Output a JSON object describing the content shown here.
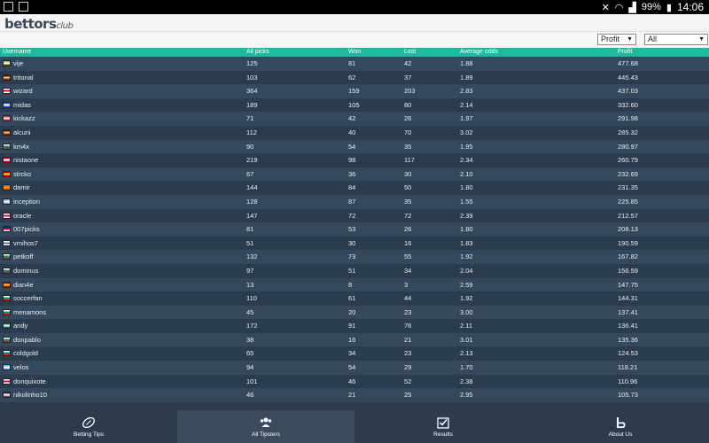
{
  "status": {
    "battery": "99%",
    "time": "14:06"
  },
  "app": {
    "logo_main": "bettors",
    "logo_sub": "club"
  },
  "filters": {
    "sort_value": "Profit",
    "range_value": "All"
  },
  "table": {
    "headers": {
      "username": "Username",
      "all_picks": "All picks",
      "won": "Won",
      "lost": "Lost",
      "average_odds": "Average odds",
      "profit": "Profit"
    },
    "rows": [
      {
        "username": "vije",
        "all": "125",
        "won": "81",
        "lost": "42",
        "odds": "1.88",
        "profit": "477.68",
        "flag": [
          "#ff9933",
          "#ffffff",
          "#138808"
        ]
      },
      {
        "username": "tritonal",
        "all": "103",
        "won": "62",
        "lost": "37",
        "odds": "1.89",
        "profit": "445.43",
        "flag": [
          "#002b7f",
          "#fcd116",
          "#ce1126"
        ]
      },
      {
        "username": "wizard",
        "all": "364",
        "won": "159",
        "lost": "203",
        "odds": "2.83",
        "profit": "437.03",
        "flag": [
          "#ffffff",
          "#d7141a",
          "#ffffff"
        ]
      },
      {
        "username": "midas",
        "all": "189",
        "won": "105",
        "lost": "80",
        "odds": "2.14",
        "profit": "332.60",
        "flag": [
          "#3a5fcd",
          "#ffffff",
          "#3a5fcd"
        ]
      },
      {
        "username": "kickazz",
        "all": "71",
        "won": "42",
        "lost": "26",
        "odds": "1.97",
        "profit": "291.98",
        "flag": [
          "#ed2939",
          "#ffffff",
          "#ed2939"
        ]
      },
      {
        "username": "alcuni",
        "all": "112",
        "won": "40",
        "lost": "70",
        "odds": "3.02",
        "profit": "285.32",
        "flag": [
          "#002b7f",
          "#fcd116",
          "#ce1126"
        ]
      },
      {
        "username": "km4x",
        "all": "90",
        "won": "54",
        "lost": "35",
        "odds": "1.95",
        "profit": "280.97",
        "flag": [
          "#ffffff",
          "#00966e",
          "#d62612"
        ]
      },
      {
        "username": "nistaone",
        "all": "219",
        "won": "98",
        "lost": "117",
        "odds": "2.34",
        "profit": "260.79",
        "flag": [
          "#c8102e",
          "#ffffff",
          "#c8102e"
        ]
      },
      {
        "username": "strcko",
        "all": "67",
        "won": "36",
        "lost": "30",
        "odds": "2.10",
        "profit": "232.69",
        "flag": [
          "#d20000",
          "#ffe600",
          "#d20000"
        ]
      },
      {
        "username": "damir",
        "all": "144",
        "won": "84",
        "lost": "50",
        "odds": "1.80",
        "profit": "231.35",
        "flag": [
          "#e35d1e",
          "#ff9f1c",
          "#e35d1e"
        ]
      },
      {
        "username": "inception",
        "all": "128",
        "won": "87",
        "lost": "35",
        "odds": "1.55",
        "profit": "225.85",
        "flag": [
          "#74acdf",
          "#ffffff",
          "#74acdf"
        ]
      },
      {
        "username": "oracle",
        "all": "147",
        "won": "72",
        "lost": "72",
        "odds": "2.39",
        "profit": "212.57",
        "flag": [
          "#ffffff",
          "#dc143c",
          "#ffffff"
        ]
      },
      {
        "username": "007picks",
        "all": "81",
        "won": "53",
        "lost": "26",
        "odds": "1.80",
        "profit": "208.13",
        "flag": [
          "#012169",
          "#c8102e",
          "#ffffff"
        ]
      },
      {
        "username": "vmihos7",
        "all": "51",
        "won": "30",
        "lost": "16",
        "odds": "1.83",
        "profit": "190.59",
        "flag": [
          "#ffffff",
          "#6b6bc8",
          "#ffffff"
        ]
      },
      {
        "username": "petkoff",
        "all": "132",
        "won": "73",
        "lost": "55",
        "odds": "1.92",
        "profit": "167.82",
        "flag": [
          "#ffffff",
          "#00966e",
          "#d62612"
        ]
      },
      {
        "username": "dominus",
        "all": "97",
        "won": "51",
        "lost": "34",
        "odds": "2.04",
        "profit": "156.59",
        "flag": [
          "#ffffff",
          "#00966e",
          "#d62612"
        ]
      },
      {
        "username": "dian4e",
        "all": "13",
        "won": "8",
        "lost": "3",
        "odds": "2.59",
        "profit": "147.75",
        "flag": [
          "#d20000",
          "#ffe600",
          "#d20000"
        ]
      },
      {
        "username": "soccerfan",
        "all": "110",
        "won": "61",
        "lost": "44",
        "odds": "1.92",
        "profit": "144.31",
        "flag": [
          "#ffffff",
          "#00966e",
          "#d62612"
        ]
      },
      {
        "username": "menamons",
        "all": "45",
        "won": "20",
        "lost": "23",
        "odds": "3.00",
        "profit": "137.41",
        "flag": [
          "#ffffff",
          "#00966e",
          "#d62612"
        ]
      },
      {
        "username": "andy",
        "all": "172",
        "won": "91",
        "lost": "76",
        "odds": "2.11",
        "profit": "136.41",
        "flag": [
          "#008751",
          "#ffffff",
          "#008751"
        ]
      },
      {
        "username": "donpablo",
        "all": "38",
        "won": "16",
        "lost": "21",
        "odds": "3.01",
        "profit": "135.36",
        "flag": [
          "#ffffff",
          "#00966e",
          "#d62612"
        ]
      },
      {
        "username": "coldgold",
        "all": "65",
        "won": "34",
        "lost": "23",
        "odds": "2.13",
        "profit": "124.53",
        "flag": [
          "#ffffff",
          "#00966e",
          "#d62612"
        ]
      },
      {
        "username": "velos",
        "all": "94",
        "won": "54",
        "lost": "29",
        "odds": "1.70",
        "profit": "118.21",
        "flag": [
          "#74acdf",
          "#ffffff",
          "#74acdf"
        ]
      },
      {
        "username": "donquixote",
        "all": "101",
        "won": "46",
        "lost": "52",
        "odds": "2.38",
        "profit": "110.96",
        "flag": [
          "#ffffff",
          "#dc143c",
          "#ffffff"
        ]
      },
      {
        "username": "nikolinho10",
        "all": "46",
        "won": "21",
        "lost": "25",
        "odds": "2.95",
        "profit": "105.73",
        "flag": [
          "#0c4076",
          "#ffffff",
          "#c6363c"
        ]
      }
    ]
  },
  "tabs": [
    {
      "label": "Betting Tips",
      "icon": "football-icon"
    },
    {
      "label": "All Tipsters",
      "icon": "people-icon"
    },
    {
      "label": "Results",
      "icon": "checklist-icon"
    },
    {
      "label": "About Us",
      "icon": "b-logo-icon"
    }
  ]
}
